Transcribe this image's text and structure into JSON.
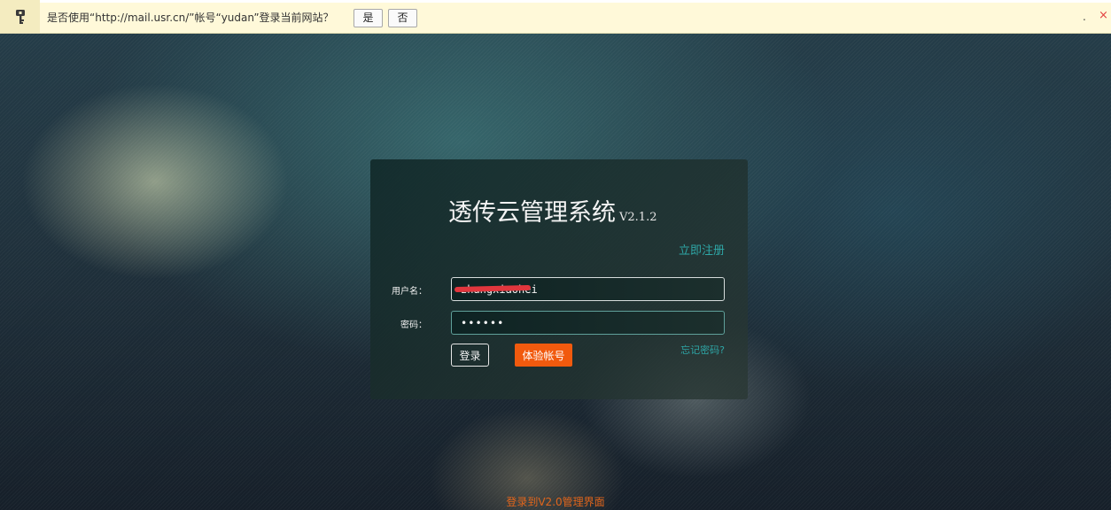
{
  "password_bar": {
    "message": "是否使用“http://mail.usr.cn/”帐号“yudan”登录当前网站？",
    "yes_label": "是",
    "no_label": "否",
    "dot": ".",
    "close_label": "×",
    "icon": "key-icon"
  },
  "login": {
    "title": "透传云管理系统",
    "version": "V2.1.2",
    "register_label": "立即注册",
    "username_label": "用户名：",
    "username_value": "zhangxiaohei",
    "password_label": "密码：",
    "password_value": "••••••",
    "forgot_label": "忘记密码?",
    "login_button": "登录",
    "trial_button": "体验帐号"
  },
  "footer": {
    "v2_link": "登录到V2.0管理界面"
  },
  "colors": {
    "accent_teal": "#2ea6a6",
    "accent_orange": "#f15a0e",
    "link_orange": "#e0651c",
    "bar_bg": "#fff9d9"
  }
}
